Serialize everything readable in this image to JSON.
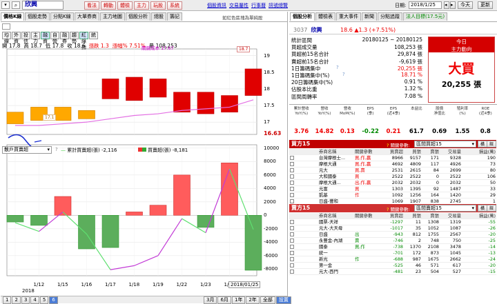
{
  "toolbar": {
    "stock_name": "欣興",
    "buttons": [
      "看法",
      "轉動",
      "體檢",
      "主力",
      "玩股",
      "系統"
    ],
    "links": [
      "個股資訊",
      "交易屬性",
      "行事曆",
      "訊號總覽"
    ],
    "date_label": "日期:",
    "date_value": "2018/1/25",
    "today_btn": "今天",
    "refresh_btn": "更新"
  },
  "left": {
    "tabs": [
      "價格K線",
      "個股走勢",
      "分點K線",
      "大單券商",
      "主力地圖",
      "個股分析",
      "總股",
      "籌記"
    ],
    "ticker_note": "如紅色區塊為單純股",
    "indicators": [
      "均線",
      "外資",
      "投信",
      "主力",
      "融資",
      "自營",
      "融券",
      "趨勢",
      "紅綠指",
      "統"
    ],
    "ohlc": {
      "open": "開 17.8",
      "high": "高 18.7",
      "low": "低 17.8",
      "close": "收 18.6",
      "chg": "漲跌 1.3",
      "pct": "漲幅% 7.51%",
      "vol": "量 108,253"
    },
    "ma_label": "關鍵成本 17.67",
    "price_axis": [
      "19",
      "18.5",
      "18",
      "17.5",
      "17",
      "16.63"
    ],
    "price_tags": {
      "top": "18.7",
      "bottom": "17.1"
    },
    "sub_select": "散戶買賣超",
    "legend": [
      {
        "label": "累計買賣超(張)",
        "value": "-2,116"
      },
      {
        "label": "買賣超(張)",
        "value": "-8,181"
      }
    ],
    "sub_axis": [
      "10000",
      "8000",
      "6000",
      "4000",
      "2000",
      "0",
      "-2000",
      "-4000",
      "-6000",
      "-8000"
    ],
    "x_labels": [
      "1/12",
      "1/15",
      "1/16",
      "1/17",
      "1/18",
      "1/19",
      "1/22",
      "1/23",
      "1/24"
    ],
    "x_year": "2018",
    "x_current": "2018/01/25",
    "pager": [
      "1",
      "2",
      "3",
      "4",
      "5",
      "6"
    ],
    "periods": [
      "3月",
      "6月",
      "1年",
      "2年",
      "全部",
      "設置"
    ]
  },
  "chart_data": [
    {
      "type": "candlestick",
      "categories": [
        "1/11",
        "1/12",
        "1/15",
        "1/16",
        "1/17",
        "1/18",
        "1/19",
        "1/22",
        "1/23",
        "1/24",
        "1/25"
      ],
      "open": [
        17.3,
        17.45,
        17.45,
        17.35,
        18.3,
        18.35,
        18.3,
        17.9,
        17.9,
        17.8,
        17.8
      ],
      "close": [
        16.95,
        17.05,
        17.05,
        17.1,
        17.7,
        17.65,
        17.75,
        17.3,
        17.25,
        17.3,
        18.6
      ],
      "ma": [
        16.9,
        16.9,
        16.95,
        17.0,
        17.1,
        17.2,
        17.25,
        17.35,
        17.4,
        17.45,
        17.67
      ],
      "ylim": [
        16.63,
        19.2
      ]
    },
    {
      "type": "bar",
      "categories": [
        "1/11",
        "1/12",
        "1/15",
        "1/16",
        "1/17",
        "1/18",
        "1/19",
        "1/22",
        "1/23",
        "1/24",
        "1/25"
      ],
      "values": [
        -1000,
        -1500,
        2800,
        -5000,
        -4800,
        500,
        1500,
        6000,
        -1800,
        7800,
        -8181
      ],
      "cumulative": [
        -1100,
        -2400,
        500,
        -2800,
        -8100,
        -7500,
        -6000,
        -500,
        -2600,
        6900,
        -2116
      ],
      "ylim": [
        -9000,
        10500
      ]
    }
  ],
  "right": {
    "tabs": [
      "個股分析",
      "體檢表",
      "重大事件",
      "新聞",
      "分點追蹤",
      "法人目標(17.5元)"
    ],
    "code": "3037",
    "name": "欣興",
    "price": "18.6",
    "chg": "▲1.3 (+7.51%)",
    "rows": [
      {
        "label": "統計區間",
        "value": "20180125 ~ 20180125"
      },
      {
        "label": "買超成交量",
        "value": "108,253 張"
      },
      {
        "label": "買超前15名合計",
        "value": "29,874 張"
      },
      {
        "label": "賣超前15名合計",
        "value": "-9,619 張"
      },
      {
        "label": "1日籌碼集中",
        "value": "20,255 張"
      },
      {
        "label": "1日籌碼集中(%)",
        "value": "18.71 %"
      },
      {
        "label": "20日籌碼集中(%)",
        "value": "0.91 %"
      },
      {
        "label": "佔股本比重",
        "value": "1.32 %"
      },
      {
        "label": "區間周轉率",
        "value": "7.08 %"
      }
    ],
    "today_box": {
      "title": "今日",
      "sub": "主力動向",
      "main": "大買",
      "value": "20,255 張"
    },
    "fin_headers": [
      "累計營收\nYoY(%)",
      "營收\nYoY(%)",
      "營收\nMoM(%)",
      "EPS\n(季)",
      "EPS\n(近4季)",
      "本益比",
      "股價\n淨值比",
      "殖利率\n(%)",
      "ROE\n(近4季)"
    ],
    "fin_values": [
      "3.76",
      "14.82",
      "0.13",
      "-0.22",
      "0.21",
      "61.7",
      "0.69",
      "1.55",
      "0.8"
    ],
    "buy": {
      "title": "買方15",
      "hint": "關鍵參數:",
      "select": "區間買超15",
      "headers": [
        "券商名稱",
        "關鍵參數",
        "買賣超",
        "買張",
        "賣張",
        "交易量",
        "損益(萬)"
      ],
      "rows": [
        [
          "台灣摩根士...",
          "買,作,贏",
          "8966",
          "9157",
          "171",
          "9328",
          "190"
        ],
        [
          "摩根大通",
          "買,作,贏",
          "4692",
          "4809",
          "117",
          "4926",
          "73"
        ],
        [
          "元大",
          "買,賣",
          "2531",
          "2615",
          "84",
          "2699",
          "80"
        ],
        [
          "大和國泰",
          "買",
          "2522",
          "2522",
          "0",
          "2522",
          "106"
        ],
        [
          "摩根大通...",
          "出,作,贏",
          "2032",
          "2032",
          "0",
          "2032",
          "50"
        ],
        [
          "元富",
          "買",
          "1303",
          "1395",
          "92",
          "1487",
          "33"
        ],
        [
          "凱基",
          "作",
          "1092",
          "1256",
          "164",
          "1420",
          "29"
        ],
        [
          "日盛-豐和",
          "",
          "1069",
          "1907",
          "838",
          "2745",
          "1"
        ],
        [
          "群益",
          "",
          "1040",
          "1549",
          "509",
          "2058",
          "27"
        ]
      ]
    },
    "sell": {
      "title": "賣方15",
      "hint": "關鍵參數:",
      "select": "區間賣超15",
      "headers": [
        "券商名稱",
        "關鍵參數",
        "買賣超",
        "買張",
        "賣張",
        "交易量",
        "損益(萬)"
      ],
      "rows": [
        [
          "國票-天祥",
          "",
          "-1297",
          "11",
          "1308",
          "1319",
          "-55"
        ],
        [
          "元大-大天母",
          "",
          "-1017",
          "35",
          "1052",
          "1087",
          "-26"
        ],
        [
          "日盛",
          "出",
          "-943",
          "812",
          "1755",
          "2567",
          "-20"
        ],
        [
          "永豐金-內湖",
          "賣",
          "-746",
          "2",
          "748",
          "750",
          "-25"
        ],
        [
          "國泰",
          "買,作",
          "-738",
          "1370",
          "2108",
          "3478",
          "-14"
        ],
        [
          "統一",
          "",
          "-701",
          "172",
          "873",
          "1045",
          "-13"
        ],
        [
          "新光",
          "作",
          "-688",
          "987",
          "1675",
          "2662",
          "-24"
        ],
        [
          "第一金",
          "",
          "-525",
          "46",
          "571",
          "617",
          "-20"
        ],
        [
          "元大-西門",
          "",
          "-481",
          "23",
          "504",
          "527",
          "-15"
        ]
      ]
    }
  }
}
